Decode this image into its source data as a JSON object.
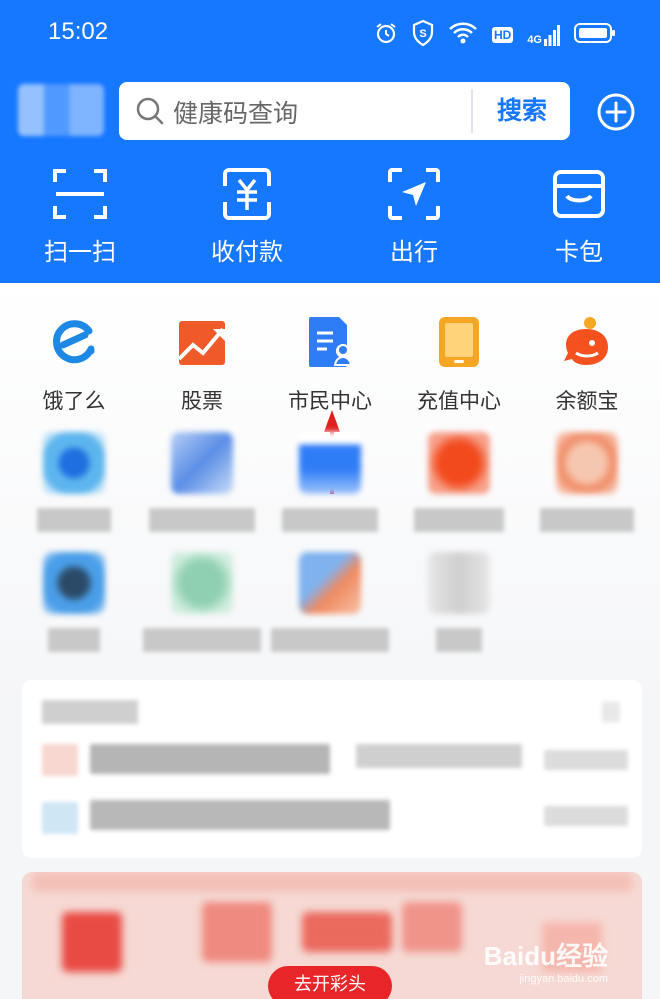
{
  "status_bar": {
    "time": "15:02",
    "icons": [
      "alarm-icon",
      "shield-icon",
      "wifi-icon",
      "hd-icon",
      "signal-4g-icon",
      "battery-icon"
    ],
    "hd_label": "HD",
    "net_label": "4G"
  },
  "header": {
    "background_color": "#1677ff",
    "search": {
      "placeholder": "健康码查询",
      "button_label": "搜索"
    },
    "quick_actions": [
      {
        "label": "扫一扫",
        "icon": "scan-icon"
      },
      {
        "label": "收付款",
        "icon": "payment-icon"
      },
      {
        "label": "出行",
        "icon": "travel-icon"
      },
      {
        "label": "卡包",
        "icon": "card-wallet-icon"
      }
    ]
  },
  "apps": [
    {
      "label": "饿了么",
      "icon": "eleme-icon",
      "color": "#1e88e5"
    },
    {
      "label": "股票",
      "icon": "stock-icon",
      "color": "#f05a28"
    },
    {
      "label": "市民中心",
      "icon": "citizen-center-icon",
      "color": "#2f7df6"
    },
    {
      "label": "充值中心",
      "icon": "recharge-icon",
      "color": "#f5a623"
    },
    {
      "label": "余额宝",
      "icon": "yuebao-icon",
      "color": "#f4511e"
    }
  ],
  "promo": {
    "button_label": "去开彩头",
    "watermark": "Baidu经验",
    "watermark_sub": "jingyan.baidu.com"
  }
}
